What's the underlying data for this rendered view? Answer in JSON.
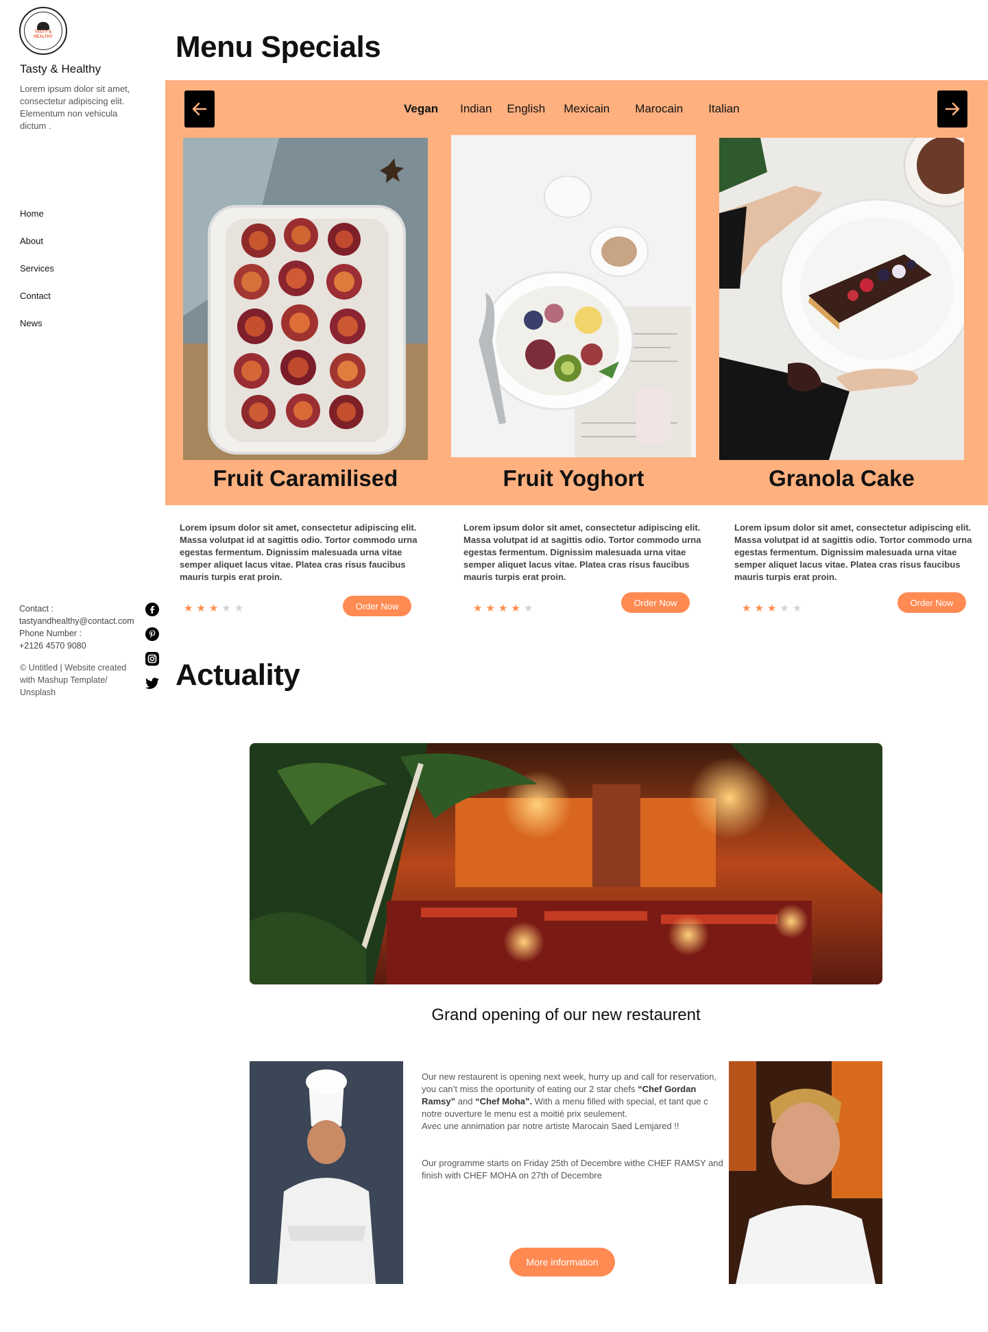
{
  "brand": {
    "logo_text": "TASTY & HEALTHY",
    "name": "Tasty & Healthy",
    "tagline": "Lorem ipsum dolor sit amet, consectetur adipiscing elit. Elementum non vehicula dictum ."
  },
  "nav": [
    "Home",
    "About",
    "Services",
    "Contact",
    "News"
  ],
  "sidebar_footer": {
    "contact_label": "Contact :",
    "email": "tastyandhealthy@contact.com",
    "phone_label": "Phone Number :",
    "phone": "+2126 4570 9080",
    "copyright": "© Untitled | Website created with Mashup Template/ Unsplash"
  },
  "socials": [
    "facebook-icon",
    "pinterest-icon",
    "instagram-icon",
    "twitter-icon"
  ],
  "menu": {
    "title": "Menu Specials",
    "tabs": [
      "Vegan",
      "Indian",
      "English",
      "Mexicain",
      "Marocain",
      "Italian"
    ],
    "active_tab": "Vegan",
    "accent": "#ffb07f",
    "button_color": "#ff8a52",
    "cards": [
      {
        "title": "Fruit Caramilised",
        "description": "Lorem ipsum dolor sit amet, consectetur adipiscing elit. Massa volutpat id at sagittis odio. Tortor commodo urna egestas fermentum. Dignissim malesuada urna vitae semper aliquet lacus vitae. Platea cras risus faucibus mauris turpis erat proin.",
        "rating": 3,
        "rating_max": 5,
        "order_label": "Order Now"
      },
      {
        "title": "Fruit Yoghort",
        "description": "Lorem ipsum dolor sit amet, consectetur adipiscing elit. Massa volutpat id at sagittis odio. Tortor commodo urna egestas fermentum. Dignissim malesuada urna vitae semper aliquet lacus vitae. Platea cras risus faucibus mauris turpis erat proin.",
        "rating": 4,
        "rating_max": 5,
        "order_label": "Order Now"
      },
      {
        "title": "Granola Cake",
        "description": "Lorem ipsum dolor sit amet, consectetur adipiscing elit. Massa volutpat id at sagittis odio. Tortor commodo urna egestas fermentum. Dignissim malesuada urna vitae semper aliquet lacus vitae. Platea cras risus faucibus mauris turpis erat proin.",
        "rating": 3,
        "rating_max": 5,
        "order_label": "Order Now"
      }
    ]
  },
  "actuality": {
    "title": "Actuality",
    "news_title": "Grand  opening of our new restaurent",
    "para1_a": "Our new restaurent is opening next week, hurry up and call for reservation, you can’t miss the oportunity of eating our 2 star chefs ",
    "chef1": "“Chef Gordan Ramsy”",
    "para1_and": " and ",
    "chef2": "“Chef Moha”.",
    "para1_b": " With a menu filled with special,  et tant que c notre ouverture le menu est a moitié prix seulement.",
    "para1_c": "Avec une annimation par notre artiste Marocain Saed Lemjared !!",
    "para2": "Our programme starts on Friday 25th of Decembre  withe CHEF RAMSY and finish with CHEF MOHA on 27th of Decembre",
    "more_label": "More information"
  }
}
